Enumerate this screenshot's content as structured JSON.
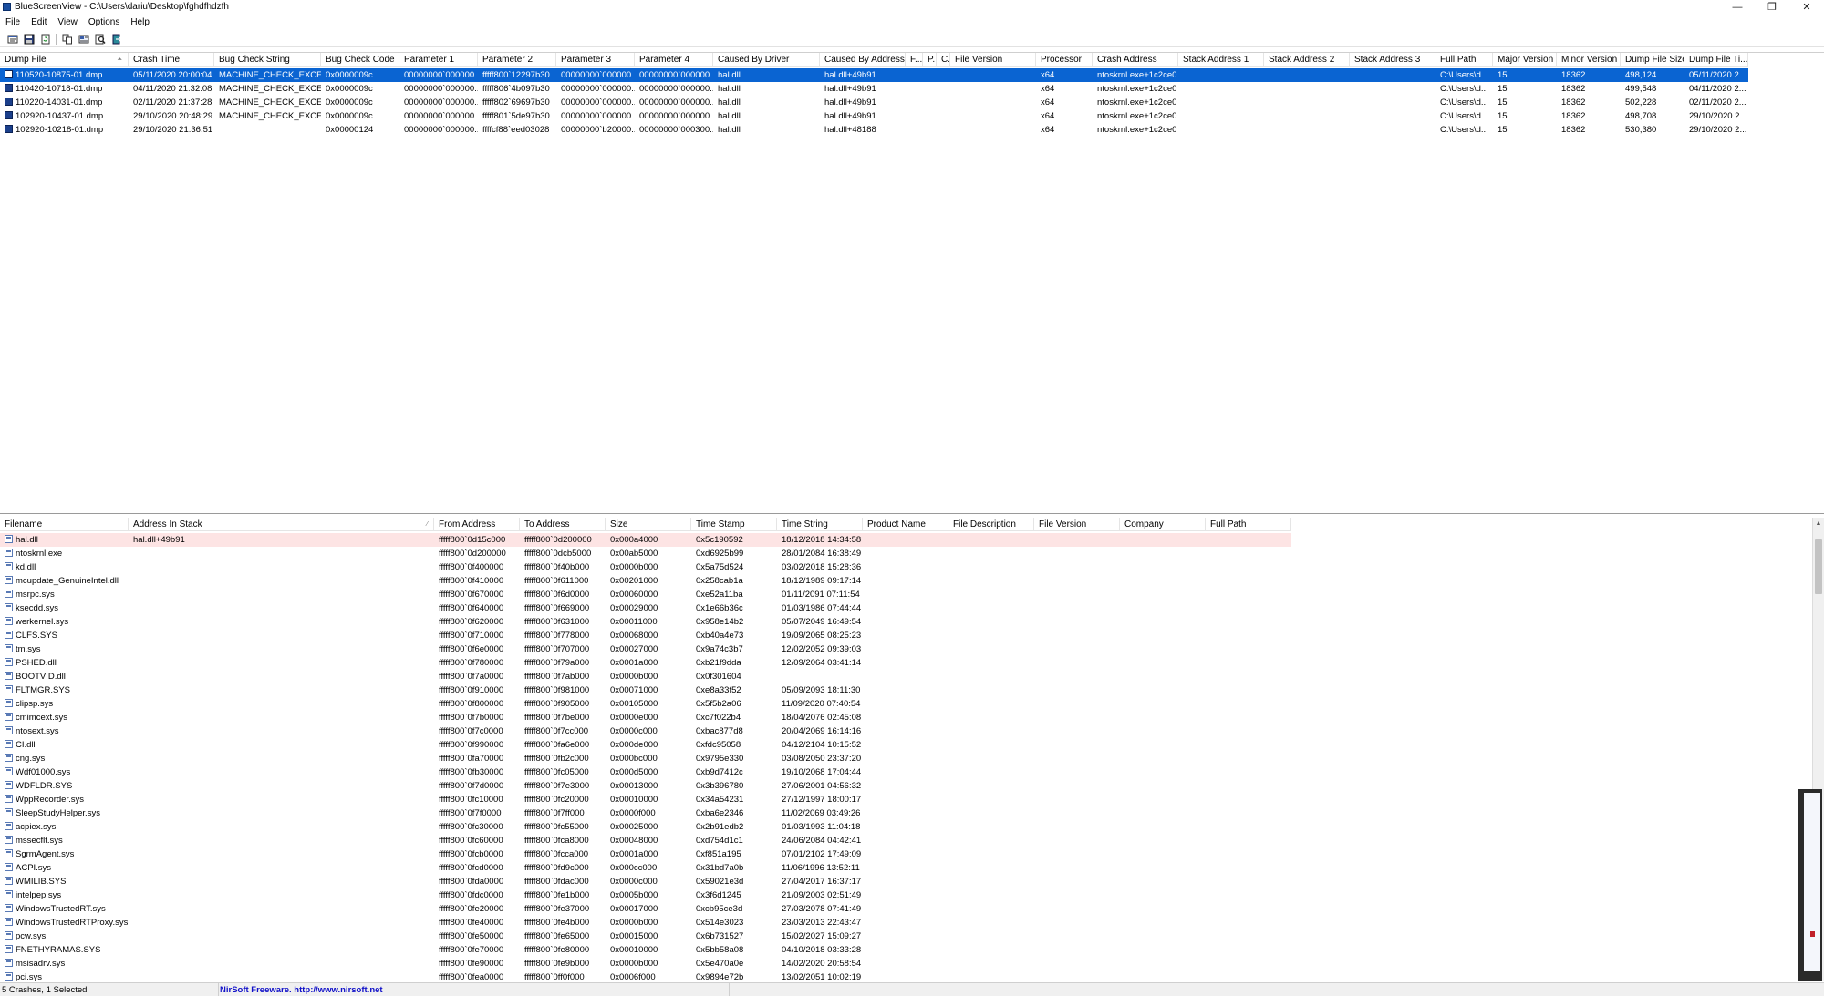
{
  "window": {
    "app_name": "BlueScreenView",
    "title": "BlueScreenView  -  C:\\Users\\dariu\\Desktop\\fghdfhdzfh",
    "controls": [
      "—",
      "❐",
      "✕"
    ]
  },
  "menu": [
    "File",
    "Edit",
    "View",
    "Options",
    "Help"
  ],
  "toolbar": [
    "properties-icon",
    "save-icon",
    "refresh-icon",
    "copy-icon",
    "html-report-icon",
    "find-icon",
    "exit-icon"
  ],
  "crash_list": {
    "columns": [
      {
        "label": "Dump File",
        "w": 141,
        "sort": "⏶"
      },
      {
        "label": "Crash Time",
        "w": 94
      },
      {
        "label": "Bug Check String",
        "w": 117
      },
      {
        "label": "Bug Check Code",
        "w": 86
      },
      {
        "label": "Parameter 1",
        "w": 86
      },
      {
        "label": "Parameter 2",
        "w": 86
      },
      {
        "label": "Parameter 3",
        "w": 86
      },
      {
        "label": "Parameter 4",
        "w": 86
      },
      {
        "label": "Caused By Driver",
        "w": 117
      },
      {
        "label": "Caused By Address",
        "w": 94
      },
      {
        "label": "F...",
        "w": 19
      },
      {
        "label": "P...",
        "w": 15
      },
      {
        "label": "C...",
        "w": 15
      },
      {
        "label": "File Version",
        "w": 94
      },
      {
        "label": "Processor",
        "w": 62
      },
      {
        "label": "Crash Address",
        "w": 94
      },
      {
        "label": "Stack Address 1",
        "w": 94
      },
      {
        "label": "Stack Address 2",
        "w": 94
      },
      {
        "label": "Stack Address 3",
        "w": 94
      },
      {
        "label": "Full Path",
        "w": 63
      },
      {
        "label": "Major Version",
        "w": 70
      },
      {
        "label": "Minor Version",
        "w": 70
      },
      {
        "label": "Dump File Size",
        "w": 70
      },
      {
        "label": "Dump File Ti...",
        "w": 70
      }
    ],
    "rows": [
      [
        "110520-10875-01.dmp",
        "05/11/2020 20:00:04",
        "MACHINE_CHECK_EXCE...",
        "0x0000009c",
        "00000000`000000...",
        "fffff800`12297b30",
        "00000000`000000...",
        "00000000`000000...",
        "hal.dll",
        "hal.dll+49b91",
        "",
        "",
        "",
        "",
        "x64",
        "ntoskrnl.exe+1c2ce0",
        "",
        "",
        "",
        "C:\\Users\\d...",
        "15",
        "18362",
        "498,124",
        "05/11/2020 2..."
      ],
      [
        "110420-10718-01.dmp",
        "04/11/2020 21:32:08",
        "MACHINE_CHECK_EXCE...",
        "0x0000009c",
        "00000000`000000...",
        "fffff806`4b097b30",
        "00000000`000000...",
        "00000000`000000...",
        "hal.dll",
        "hal.dll+49b91",
        "",
        "",
        "",
        "",
        "x64",
        "ntoskrnl.exe+1c2ce0",
        "",
        "",
        "",
        "C:\\Users\\d...",
        "15",
        "18362",
        "499,548",
        "04/11/2020 2..."
      ],
      [
        "110220-14031-01.dmp",
        "02/11/2020 21:37:28",
        "MACHINE_CHECK_EXCE...",
        "0x0000009c",
        "00000000`000000...",
        "fffff802`69697b30",
        "00000000`000000...",
        "00000000`000000...",
        "hal.dll",
        "hal.dll+49b91",
        "",
        "",
        "",
        "",
        "x64",
        "ntoskrnl.exe+1c2ce0",
        "",
        "",
        "",
        "C:\\Users\\d...",
        "15",
        "18362",
        "502,228",
        "02/11/2020 2..."
      ],
      [
        "102920-10437-01.dmp",
        "29/10/2020 20:48:29",
        "MACHINE_CHECK_EXCE...",
        "0x0000009c",
        "00000000`000000...",
        "fffff801`5de97b30",
        "00000000`000000...",
        "00000000`000000...",
        "hal.dll",
        "hal.dll+49b91",
        "",
        "",
        "",
        "",
        "x64",
        "ntoskrnl.exe+1c2ce0",
        "",
        "",
        "",
        "C:\\Users\\d...",
        "15",
        "18362",
        "498,708",
        "29/10/2020 2..."
      ],
      [
        "102920-10218-01.dmp",
        "29/10/2020 21:36:51",
        "",
        "0x00000124",
        "00000000`000000...",
        "ffffcf88`eed03028",
        "00000000`b20000...",
        "00000000`000300...",
        "hal.dll",
        "hal.dll+48188",
        "",
        "",
        "",
        "",
        "x64",
        "ntoskrnl.exe+1c2ce0",
        "",
        "",
        "",
        "C:\\Users\\d...",
        "15",
        "18362",
        "530,380",
        "29/10/2020 2..."
      ]
    ],
    "selected_index": 0
  },
  "module_list": {
    "columns": [
      {
        "label": "Filename",
        "w": 141
      },
      {
        "label": "Address In Stack",
        "w": 335,
        "sort": "⁄"
      },
      {
        "label": "From Address",
        "w": 94
      },
      {
        "label": "To Address",
        "w": 94
      },
      {
        "label": "Size",
        "w": 94
      },
      {
        "label": "Time Stamp",
        "w": 94
      },
      {
        "label": "Time String",
        "w": 94
      },
      {
        "label": "Product Name",
        "w": 94
      },
      {
        "label": "File Description",
        "w": 94
      },
      {
        "label": "File Version",
        "w": 94
      },
      {
        "label": "Company",
        "w": 94
      },
      {
        "label": "Full Path",
        "w": 94
      }
    ],
    "rows": [
      [
        "hal.dll",
        "hal.dll+49b91",
        "fffff800`0d15c000",
        "fffff800`0d200000",
        "0x000a4000",
        "0x5c190592",
        "18/12/2018 14:34:58"
      ],
      [
        "ntoskrnl.exe",
        "",
        "fffff800`0d200000",
        "fffff800`0dcb5000",
        "0x00ab5000",
        "0xd6925b99",
        "28/01/2084 16:38:49"
      ],
      [
        "kd.dll",
        "",
        "fffff800`0f400000",
        "fffff800`0f40b000",
        "0x0000b000",
        "0x5a75d524",
        "03/02/2018 15:28:36"
      ],
      [
        "mcupdate_GenuineIntel.dll",
        "",
        "fffff800`0f410000",
        "fffff800`0f611000",
        "0x00201000",
        "0x258cab1a",
        "18/12/1989 09:17:14"
      ],
      [
        "msrpc.sys",
        "",
        "fffff800`0f670000",
        "fffff800`0f6d0000",
        "0x00060000",
        "0xe52a11ba",
        "01/11/2091 07:11:54"
      ],
      [
        "ksecdd.sys",
        "",
        "fffff800`0f640000",
        "fffff800`0f669000",
        "0x00029000",
        "0x1e66b36c",
        "01/03/1986 07:44:44"
      ],
      [
        "werkernel.sys",
        "",
        "fffff800`0f620000",
        "fffff800`0f631000",
        "0x00011000",
        "0x958e14b2",
        "05/07/2049 16:49:54"
      ],
      [
        "CLFS.SYS",
        "",
        "fffff800`0f710000",
        "fffff800`0f778000",
        "0x00068000",
        "0xb40a4e73",
        "19/09/2065 08:25:23"
      ],
      [
        "tm.sys",
        "",
        "fffff800`0f6e0000",
        "fffff800`0f707000",
        "0x00027000",
        "0x9a74c3b7",
        "12/02/2052 09:39:03"
      ],
      [
        "PSHED.dll",
        "",
        "fffff800`0f780000",
        "fffff800`0f79a000",
        "0x0001a000",
        "0xb21f9dda",
        "12/09/2064 03:41:14"
      ],
      [
        "BOOTVID.dll",
        "",
        "fffff800`0f7a0000",
        "fffff800`0f7ab000",
        "0x0000b000",
        "0x0f301604",
        ""
      ],
      [
        "FLTMGR.SYS",
        "",
        "fffff800`0f910000",
        "fffff800`0f981000",
        "0x00071000",
        "0xe8a33f52",
        "05/09/2093 18:11:30"
      ],
      [
        "clipsp.sys",
        "",
        "fffff800`0f800000",
        "fffff800`0f905000",
        "0x00105000",
        "0x5f5b2a06",
        "11/09/2020 07:40:54"
      ],
      [
        "cmimcext.sys",
        "",
        "fffff800`0f7b0000",
        "fffff800`0f7be000",
        "0x0000e000",
        "0xc7f022b4",
        "18/04/2076 02:45:08"
      ],
      [
        "ntosext.sys",
        "",
        "fffff800`0f7c0000",
        "fffff800`0f7cc000",
        "0x0000c000",
        "0xbac877d8",
        "20/04/2069 16:14:16"
      ],
      [
        "CI.dll",
        "",
        "fffff800`0f990000",
        "fffff800`0fa6e000",
        "0x000de000",
        "0xfdc95058",
        "04/12/2104 10:15:52"
      ],
      [
        "cng.sys",
        "",
        "fffff800`0fa70000",
        "fffff800`0fb2c000",
        "0x000bc000",
        "0x9795e330",
        "03/08/2050 23:37:20"
      ],
      [
        "Wdf01000.sys",
        "",
        "fffff800`0fb30000",
        "fffff800`0fc05000",
        "0x000d5000",
        "0xb9d7412c",
        "19/10/2068 17:04:44"
      ],
      [
        "WDFLDR.SYS",
        "",
        "fffff800`0f7d0000",
        "fffff800`0f7e3000",
        "0x00013000",
        "0x3b396780",
        "27/06/2001 04:56:32"
      ],
      [
        "WppRecorder.sys",
        "",
        "fffff800`0fc10000",
        "fffff800`0fc20000",
        "0x00010000",
        "0x34a54231",
        "27/12/1997 18:00:17"
      ],
      [
        "SleepStudyHelper.sys",
        "",
        "fffff800`0f7f0000",
        "fffff800`0f7ff000",
        "0x0000f000",
        "0xba6e2346",
        "11/02/2069 03:49:26"
      ],
      [
        "acpiex.sys",
        "",
        "fffff800`0fc30000",
        "fffff800`0fc55000",
        "0x00025000",
        "0x2b91edb2",
        "01/03/1993 11:04:18"
      ],
      [
        "mssecflt.sys",
        "",
        "fffff800`0fc60000",
        "fffff800`0fca8000",
        "0x00048000",
        "0xd754d1c1",
        "24/06/2084 04:42:41"
      ],
      [
        "SgrmAgent.sys",
        "",
        "fffff800`0fcb0000",
        "fffff800`0fcca000",
        "0x0001a000",
        "0xf851a195",
        "07/01/2102 17:49:09"
      ],
      [
        "ACPI.sys",
        "",
        "fffff800`0fcd0000",
        "fffff800`0fd9c000",
        "0x000cc000",
        "0x31bd7a0b",
        "11/06/1996 13:52:11"
      ],
      [
        "WMILIB.SYS",
        "",
        "fffff800`0fda0000",
        "fffff800`0fdac000",
        "0x0000c000",
        "0x59021e3d",
        "27/04/2017 16:37:17"
      ],
      [
        "intelpep.sys",
        "",
        "fffff800`0fdc0000",
        "fffff800`0fe1b000",
        "0x0005b000",
        "0x3f6d1245",
        "21/09/2003 02:51:49"
      ],
      [
        "WindowsTrustedRT.sys",
        "",
        "fffff800`0fe20000",
        "fffff800`0fe37000",
        "0x00017000",
        "0xcb95ce3d",
        "27/03/2078 07:41:49"
      ],
      [
        "WindowsTrustedRTProxy.sys",
        "",
        "fffff800`0fe40000",
        "fffff800`0fe4b000",
        "0x0000b000",
        "0x514e3023",
        "23/03/2013 22:43:47"
      ],
      [
        "pcw.sys",
        "",
        "fffff800`0fe50000",
        "fffff800`0fe65000",
        "0x00015000",
        "0x6b731527",
        "15/02/2027 15:09:27"
      ],
      [
        "FNETHYRAMAS.SYS",
        "",
        "fffff800`0fe70000",
        "fffff800`0fe80000",
        "0x00010000",
        "0x5bb58a08",
        "04/10/2018 03:33:28"
      ],
      [
        "msisadrv.sys",
        "",
        "fffff800`0fe90000",
        "fffff800`0fe9b000",
        "0x0000b000",
        "0x5e470a0e",
        "14/02/2020 20:58:54"
      ],
      [
        "pci.sys",
        "",
        "fffff800`0fea0000",
        "fffff800`0ff0f000",
        "0x0006f000",
        "0x9894e72b",
        "13/02/2051 10:02:19"
      ]
    ],
    "highlight_index": 0
  },
  "status": {
    "count": "5 Crashes, 1 Selected",
    "credit": "NirSoft Freeware.  http://www.nirsoft.net"
  },
  "colors": {
    "selection": "#0a64d2",
    "highlight": "#fde4e4",
    "link": "#1010c8"
  }
}
